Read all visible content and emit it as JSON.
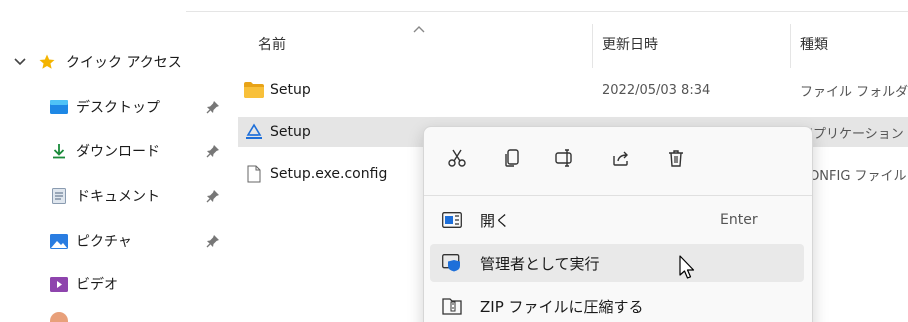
{
  "sidebar": {
    "quick_access": "クイック アクセス",
    "items": [
      {
        "label": "デスクトップ",
        "icon": "desktop-icon",
        "pinned": true
      },
      {
        "label": "ダウンロード",
        "icon": "download-icon",
        "pinned": true
      },
      {
        "label": "ドキュメント",
        "icon": "documents-icon",
        "pinned": true
      },
      {
        "label": "ピクチャ",
        "icon": "pictures-icon",
        "pinned": true
      },
      {
        "label": "ビデオ",
        "icon": "videos-icon",
        "pinned": false
      }
    ]
  },
  "columns": {
    "name": "名前",
    "date": "更新日時",
    "type": "種類"
  },
  "files": [
    {
      "name": "Setup",
      "date": "2022/05/03 8:34",
      "type": "ファイル フォルダー",
      "icon": "folder-icon"
    },
    {
      "name": "Setup",
      "date": "",
      "type": "アプリケーション",
      "icon": "installer-icon"
    },
    {
      "name": "Setup.exe.config",
      "date": "",
      "type": "CONFIG ファイル",
      "icon": "file-icon"
    }
  ],
  "context_menu": {
    "icons": [
      "cut-icon",
      "copy-icon",
      "rename-icon",
      "share-icon",
      "delete-icon"
    ],
    "items": [
      {
        "label": "開く",
        "shortcut": "Enter",
        "icon": "open-icon"
      },
      {
        "label": "管理者として実行",
        "shortcut": "",
        "icon": "shield-icon"
      },
      {
        "label": "ZIP ファイルに圧縮する",
        "shortcut": "",
        "icon": "zip-icon"
      }
    ]
  },
  "colors": {
    "selection": "#e5e5e5",
    "accent": "#0067c0",
    "folder": "#f8c03a"
  }
}
